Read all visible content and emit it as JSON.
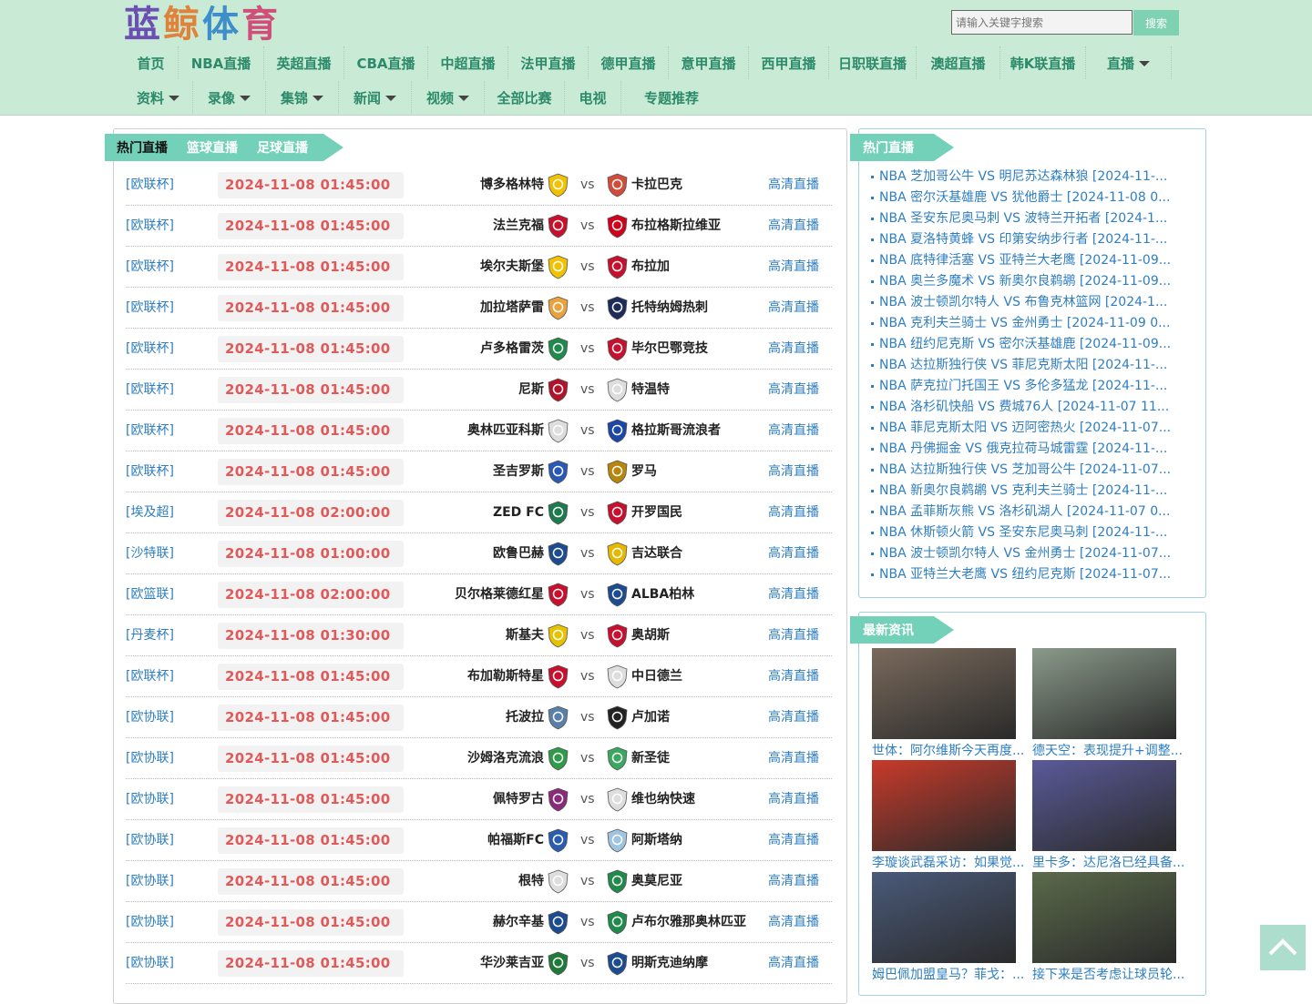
{
  "brand": {
    "logo": [
      "蓝",
      "鲸",
      "体",
      "育"
    ]
  },
  "search": {
    "placeholder": "请输入关键字搜索",
    "button": "搜索"
  },
  "nav": {
    "row1": [
      {
        "label": "首页",
        "caret": false
      },
      {
        "label": "NBA直播",
        "caret": false
      },
      {
        "label": "英超直播",
        "caret": false
      },
      {
        "label": "CBA直播",
        "caret": false
      },
      {
        "label": "中超直播",
        "caret": false
      },
      {
        "label": "法甲直播",
        "caret": false
      },
      {
        "label": "德甲直播",
        "caret": false
      },
      {
        "label": "意甲直播",
        "caret": false
      },
      {
        "label": "西甲直播",
        "caret": false
      },
      {
        "label": "日职联直播",
        "caret": false
      },
      {
        "label": "澳超直播",
        "caret": false
      },
      {
        "label": "韩K联直播",
        "caret": false
      },
      {
        "label": "直播",
        "caret": true
      }
    ],
    "row2": [
      {
        "label": "资料",
        "caret": true
      },
      {
        "label": "录像",
        "caret": true
      },
      {
        "label": "集锦",
        "caret": true
      },
      {
        "label": "新闻",
        "caret": true
      },
      {
        "label": "视频",
        "caret": true
      },
      {
        "label": "全部比赛",
        "caret": false
      },
      {
        "label": "电视",
        "caret": false
      },
      {
        "label": "专题推荐",
        "caret": false
      }
    ]
  },
  "tabs": [
    "热门直播",
    "篮球直播",
    "足球直播"
  ],
  "live_label": "高清直播",
  "vs_label": "vs",
  "matches": [
    {
      "league": "[欧联杯]",
      "time": "2024-11-08 01:45:00",
      "home": "博多格林特",
      "away": "卡拉巴克",
      "home_color": "#f2c200",
      "away_color": "#d24c3a"
    },
    {
      "league": "[欧联杯]",
      "time": "2024-11-08 01:45:00",
      "home": "法兰克福",
      "away": "布拉格斯拉维亚",
      "home_color": "#c8102e",
      "away_color": "#d0021b"
    },
    {
      "league": "[欧联杯]",
      "time": "2024-11-08 01:45:00",
      "home": "埃尔夫斯堡",
      "away": "布拉加",
      "home_color": "#f2c200",
      "away_color": "#c8102e"
    },
    {
      "league": "[欧联杯]",
      "time": "2024-11-08 01:45:00",
      "home": "加拉塔萨雷",
      "away": "托特纳姆热刺",
      "home_color": "#e8a33d",
      "away_color": "#1d2b5b"
    },
    {
      "league": "[欧联杯]",
      "time": "2024-11-08 01:45:00",
      "home": "卢多格雷茨",
      "away": "毕尔巴鄂竞技",
      "home_color": "#1f8a4c",
      "away_color": "#c8102e"
    },
    {
      "league": "[欧联杯]",
      "time": "2024-11-08 01:45:00",
      "home": "尼斯",
      "away": "特温特",
      "home_color": "#b3122b",
      "away_color": "#dddddd"
    },
    {
      "league": "[欧联杯]",
      "time": "2024-11-08 01:45:00",
      "home": "奥林匹亚科斯",
      "away": "格拉斯哥流浪者",
      "home_color": "#dddddd",
      "away_color": "#1b47a6"
    },
    {
      "league": "[欧联杯]",
      "time": "2024-11-08 01:45:00",
      "home": "圣吉罗斯",
      "away": "罗马",
      "home_color": "#2a58b5",
      "away_color": "#b8860b"
    },
    {
      "league": "[埃及超]",
      "time": "2024-11-08 02:00:00",
      "home": "ZED FC",
      "away": "开罗国民",
      "home_color": "#1c7a4f",
      "away_color": "#c8102e"
    },
    {
      "league": "[沙特联]",
      "time": "2024-11-08 01:00:00",
      "home": "欧鲁巴赫",
      "away": "吉达联合",
      "home_color": "#1d4b8f",
      "away_color": "#e6b800"
    },
    {
      "league": "[欧篮联]",
      "time": "2024-11-08 02:00:00",
      "home": "贝尔格莱德红星",
      "away": "ALBA柏林",
      "home_color": "#c8102e",
      "away_color": "#1d4b8f"
    },
    {
      "league": "[丹麦杯]",
      "time": "2024-11-08 01:30:00",
      "home": "斯基夫",
      "away": "奥胡斯",
      "home_color": "#e6c200",
      "away_color": "#c8102e"
    },
    {
      "league": "[欧联杯]",
      "time": "2024-11-08 01:45:00",
      "home": "布加勒斯特星",
      "away": "中日德兰",
      "home_color": "#c8102e",
      "away_color": "#dddddd"
    },
    {
      "league": "[欧协联]",
      "time": "2024-11-08 01:45:00",
      "home": "托波拉",
      "away": "卢加诺",
      "home_color": "#5a7fa8",
      "away_color": "#222222"
    },
    {
      "league": "[欧协联]",
      "time": "2024-11-08 01:45:00",
      "home": "沙姆洛克流浪",
      "away": "新圣徒",
      "home_color": "#2f9a47",
      "away_color": "#3aa860"
    },
    {
      "league": "[欧协联]",
      "time": "2024-11-08 01:45:00",
      "home": "佩特罗古",
      "away": "维也纳快速",
      "home_color": "#8a2a7a",
      "away_color": "#dddddd"
    },
    {
      "league": "[欧协联]",
      "time": "2024-11-08 01:45:00",
      "home": "帕福斯FC",
      "away": "阿斯塔纳",
      "home_color": "#2a5db0",
      "away_color": "#9fc4e0"
    },
    {
      "league": "[欧协联]",
      "time": "2024-11-08 01:45:00",
      "home": "根特",
      "away": "奥莫尼亚",
      "home_color": "#dddddd",
      "away_color": "#1f8a4c"
    },
    {
      "league": "[欧协联]",
      "time": "2024-11-08 01:45:00",
      "home": "赫尔辛基",
      "away": "卢布尔雅那奥林匹亚",
      "home_color": "#1d4b8f",
      "away_color": "#1f8a4c"
    },
    {
      "league": "[欧协联]",
      "time": "2024-11-08 01:45:00",
      "home": "华沙莱吉亚",
      "away": "明斯克迪纳摩",
      "home_color": "#1f7a3a",
      "away_color": "#1d4b8f"
    }
  ],
  "hot_title": "热门直播",
  "hot": [
    "NBA 芝加哥公牛 VS 明尼苏达森林狼 [2024-11-...",
    "NBA 密尔沃基雄鹿 VS 犹他爵士 [2024-11-08 0...",
    "NBA 圣安东尼奥马刺 VS 波特兰开拓者 [2024-1...",
    "NBA 夏洛特黄蜂 VS 印第安纳步行者 [2024-11-...",
    "NBA 底特律活塞 VS 亚特兰大老鹰 [2024-11-09...",
    "NBA 奥兰多魔术 VS 新奥尔良鹈鹕 [2024-11-09...",
    "NBA 波士顿凯尔特人 VS 布鲁克林篮网 [2024-1...",
    "NBA 克利夫兰骑士 VS 金州勇士 [2024-11-09 0...",
    "NBA 纽约尼克斯 VS 密尔沃基雄鹿 [2024-11-09...",
    "NBA 达拉斯独行侠 VS 菲尼克斯太阳 [2024-11-...",
    "NBA 萨克拉门托国王 VS 多伦多猛龙 [2024-11-...",
    "NBA 洛杉矶快船 VS 费城76人 [2024-11-07 11...",
    "NBA 菲尼克斯太阳 VS 迈阿密热火 [2024-11-07...",
    "NBA 丹佛掘金 VS 俄克拉荷马城雷霆 [2024-11-...",
    "NBA 达拉斯独行侠 VS 芝加哥公牛 [2024-11-07...",
    "NBA 新奥尔良鹈鹕 VS 克利夫兰骑士 [2024-11-...",
    "NBA 孟菲斯灰熊 VS 洛杉矶湖人 [2024-11-07 0...",
    "NBA 休斯顿火箭 VS 圣安东尼奥马刺 [2024-11-...",
    "NBA 波士顿凯尔特人 VS 金州勇士 [2024-11-07...",
    "NBA 亚特兰大老鹰 VS 纽约尼克斯 [2024-11-07..."
  ],
  "news_title": "最新资讯",
  "news": [
    {
      "caption": "世体：阿尔维斯今天再度...",
      "bg": "#7a6a5c"
    },
    {
      "caption": "德天空：表现提升+调整...",
      "bg": "#8a9a8a"
    },
    {
      "caption": "李璇谈武磊采访：如果觉...",
      "bg": "#c83a2a"
    },
    {
      "caption": "里卡多：达尼洛已经具备...",
      "bg": "#5a5a9a"
    },
    {
      "caption": "姆巴佩加盟皇马？菲戈：...",
      "bg": "#4a5a7a"
    },
    {
      "caption": "接下来是否考虑让球员轮...",
      "bg": "#5a6a4a"
    }
  ]
}
